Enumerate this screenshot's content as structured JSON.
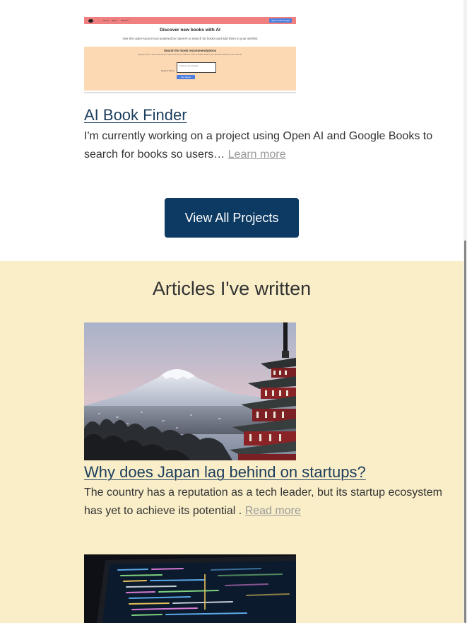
{
  "project": {
    "screenshot": {
      "nav_items": [
        "Home",
        "Sign in",
        "Wishlist"
      ],
      "signin_label": "Sign in with Google",
      "hero_title": "Discover new books with AI",
      "hero_sub": "Use this open-source tool powered by OpenAI to search for books and add them to your wishlist",
      "search_title": "Search for book recommendations",
      "search_sub": "Simply enter a book prompt for OpenAI and you will see a list of books which you can then add to your book list.",
      "field_label": "Search Terms",
      "field_placeholder": "Find me sci fi books",
      "button_label": "Get books"
    },
    "title": "AI Book Finder",
    "description": "I'm currently working on a project using Open AI and Google Books to search for books so users…",
    "learn_more": "Learn more"
  },
  "view_all_label": "View All Projects",
  "articles": {
    "heading": "Articles I've written",
    "items": [
      {
        "title": "Why does Japan lag behind on startups?",
        "description": "The country has a reputation as a tech leader, but its startup ecosystem has yet to achieve its potential .",
        "read_more": "Read more"
      }
    ]
  },
  "colors": {
    "primary": "#0c3a63",
    "articles_bg": "#f9eec8",
    "link": "#1b3d5c",
    "muted": "#999999"
  }
}
